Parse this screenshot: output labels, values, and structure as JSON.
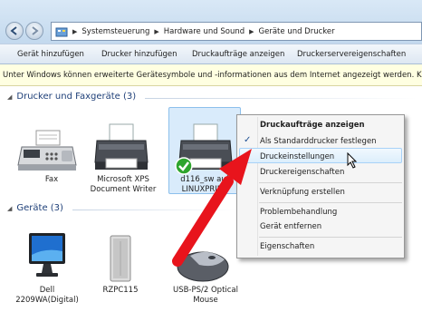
{
  "breadcrumb": {
    "items": [
      "Systemsteuerung",
      "Hardware und Sound",
      "Geräte und Drucker"
    ]
  },
  "toolbar": {
    "buttons": [
      "Gerät hinzufügen",
      "Drucker hinzufügen",
      "Druckaufträge anzeigen",
      "Druckerservereigenschaften"
    ]
  },
  "infobar": {
    "text": "Unter Windows können erweiterte Gerätesymbole und -informationen aus dem Internet angezeigt werden. Klicken"
  },
  "groups": {
    "printers": {
      "title": "Drucker und Faxgeräte (3)",
      "items": [
        {
          "label_1": "Fax",
          "label_2": ""
        },
        {
          "label_1": "Microsoft XPS",
          "label_2": "Document Writer"
        },
        {
          "label_1": "d116_sw auf",
          "label_2": "LINUXPRINT"
        }
      ]
    },
    "devices": {
      "title": "Geräte (3)",
      "items": [
        {
          "label_1": "Dell",
          "label_2": "2209WA(Digital)"
        },
        {
          "label_1": "RZPC115",
          "label_2": ""
        },
        {
          "label_1": "USB-PS/2 Optical",
          "label_2": "Mouse"
        }
      ]
    }
  },
  "context_menu": {
    "items": [
      "Druckaufträge anzeigen",
      "Als Standarddrucker festlegen",
      "Druckeinstellungen",
      "Druckereigenschaften",
      "Verknüpfung erstellen",
      "Problembehandlung",
      "Gerät entfernen",
      "Eigenschaften"
    ],
    "checkmark": "✓"
  },
  "colors": {
    "arrow": "#e8141c",
    "group_header": "#1e3f78",
    "selection": "#d9ebfb",
    "infobar": "#ffffe1"
  },
  "icons": [
    "back-arrow-icon",
    "forward-arrow-icon",
    "control-panel-icon",
    "fax-icon",
    "printer-icon",
    "default-check-icon",
    "monitor-icon",
    "computer-icon",
    "mouse-icon",
    "mouse-cursor-icon",
    "red-arrow"
  ]
}
